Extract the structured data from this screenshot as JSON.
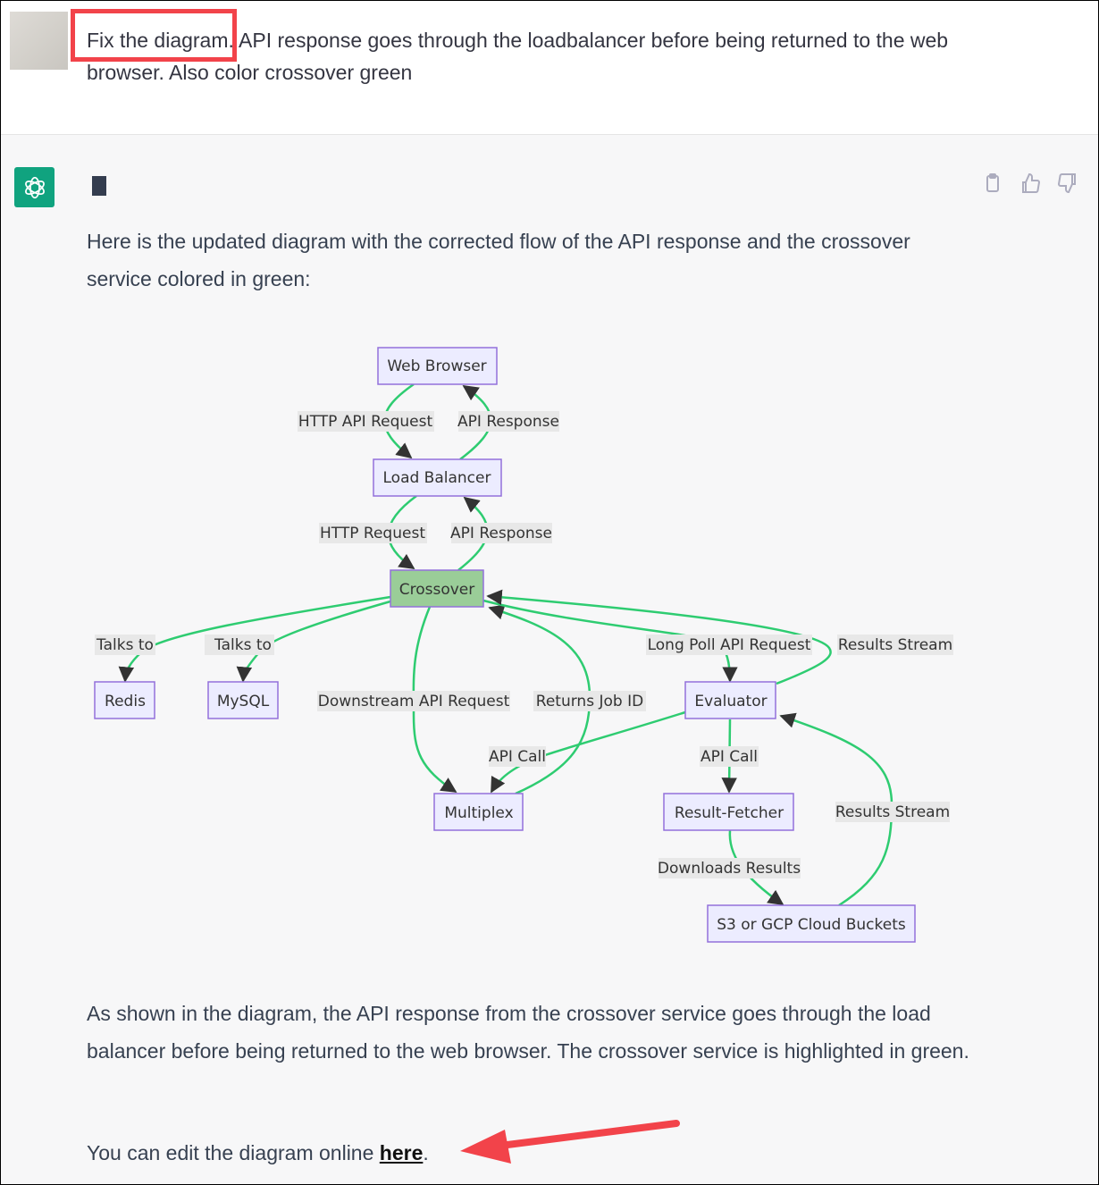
{
  "user_message": {
    "highlighted": "Fix the diagram.",
    "text": " API response goes through the loadbalancer before being returned to the web browser. Also color crossover green"
  },
  "assistant": {
    "intro": "Here is the updated diagram with the corrected flow of the API response and the crossover service colored in green:",
    "explanation": "As shown in the diagram, the API response from the crossover service goes through the load balancer before being returned to the web browser. The crossover service is highlighted in green.",
    "edit_prefix": "You can edit the diagram online ",
    "edit_link": "here",
    "edit_suffix": ".",
    "actions": [
      "copy-icon",
      "thumbs-up-icon",
      "thumbs-down-icon"
    ]
  },
  "diagram": {
    "nodes": {
      "web_browser": "Web Browser",
      "load_balancer": "Load Balancer",
      "crossover": "Crossover",
      "redis": "Redis",
      "mysql": "MySQL",
      "multiplex": "Multiplex",
      "evaluator": "Evaluator",
      "result_fetcher": "Result-Fetcher",
      "buckets": "S3 or GCP Cloud Buckets"
    },
    "edges": {
      "http_api_request": "HTTP API Request",
      "api_response_1": "API Response",
      "http_request": "HTTP Request",
      "api_response_2": "API Response",
      "talks_to_redis": "Talks to",
      "talks_to_mysql": "Talks to",
      "downstream": "Downstream API Request",
      "returns_job": "Returns Job ID",
      "long_poll": "Long Poll API Request",
      "results_stream_1": "Results Stream",
      "api_call_multiplex": "API Call",
      "api_call_fetcher": "API Call",
      "downloads": "Downloads Results",
      "results_stream_2": "Results Stream"
    },
    "colors": {
      "node_fill": "#ececff",
      "node_stroke": "#9370db",
      "crossover_fill": "#9acd98",
      "edge": "#2ecc71"
    }
  },
  "annotations": {
    "box_color": "#f2434a",
    "arrow_color": "#f2434a"
  }
}
